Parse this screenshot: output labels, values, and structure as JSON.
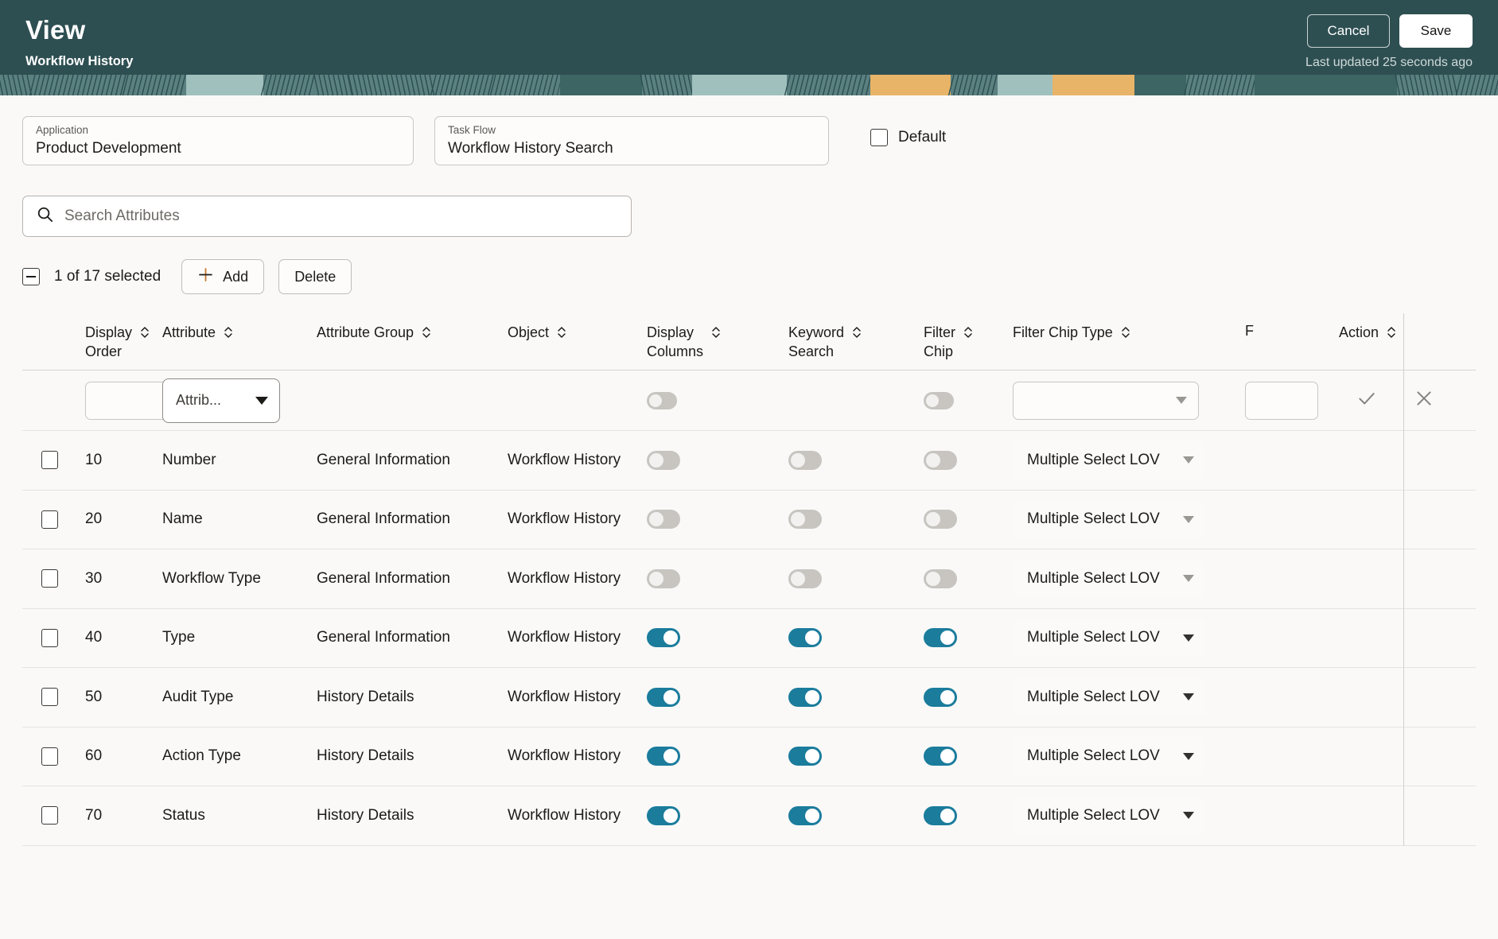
{
  "header": {
    "title": "View",
    "subtitle": "Workflow History",
    "cancel_label": "Cancel",
    "save_label": "Save",
    "last_updated": "Last updated 25 seconds ago",
    "bg_color": "#2e4f52"
  },
  "fields": {
    "application": {
      "label": "Application",
      "value": "Product Development"
    },
    "task_flow": {
      "label": "Task Flow",
      "value": "Workflow History Search"
    },
    "default": {
      "label": "Default",
      "checked": false
    }
  },
  "search": {
    "placeholder": "Search Attributes",
    "value": ""
  },
  "toolbar": {
    "selection_text": "1 of 17 selected",
    "add_label": "Add",
    "delete_label": "Delete",
    "add_icon": "plus-icon",
    "select_all_state": "indeterminate"
  },
  "table": {
    "columns": [
      {
        "key": "display_order",
        "label": "Display\nOrder",
        "sortable": true
      },
      {
        "key": "attribute",
        "label": "Attribute",
        "sortable": true
      },
      {
        "key": "attribute_group",
        "label": "Attribute Group",
        "sortable": true
      },
      {
        "key": "object",
        "label": "Object",
        "sortable": true
      },
      {
        "key": "display_columns",
        "label": "Display\nColumns",
        "sortable": true
      },
      {
        "key": "keyword_search",
        "label": "Keyword\nSearch",
        "sortable": true
      },
      {
        "key": "filter_chip",
        "label": "Filter\nChip",
        "sortable": true
      },
      {
        "key": "filter_chip_type",
        "label": "Filter Chip Type",
        "sortable": true
      },
      {
        "key": "truncated",
        "label": "F",
        "sortable": false
      },
      {
        "key": "action",
        "label": "Action",
        "sortable": true
      }
    ],
    "edit_row": {
      "display_order": "",
      "attribute_placeholder": "Attrib...",
      "display_columns": false,
      "filter_chip": false,
      "filter_chip_type": "",
      "confirm_icon": "check-icon",
      "cancel_icon": "close-icon"
    },
    "rows": [
      {
        "selected": false,
        "display_order": "10",
        "attribute": "Number",
        "attribute_group": "General Information",
        "object": "Workflow History",
        "display_columns": false,
        "keyword_search": false,
        "filter_chip": false,
        "filter_chip_type": "Multiple Select LOV",
        "disabled": true
      },
      {
        "selected": false,
        "display_order": "20",
        "attribute": "Name",
        "attribute_group": "General Information",
        "object": "Workflow History",
        "display_columns": false,
        "keyword_search": false,
        "filter_chip": false,
        "filter_chip_type": "Multiple Select LOV",
        "disabled": true
      },
      {
        "selected": false,
        "display_order": "30",
        "attribute": "Workflow Type",
        "attribute_group": "General Information",
        "object": "Workflow History",
        "display_columns": false,
        "keyword_search": false,
        "filter_chip": false,
        "filter_chip_type": "Multiple Select LOV",
        "disabled": true
      },
      {
        "selected": false,
        "display_order": "40",
        "attribute": "Type",
        "attribute_group": "General Information",
        "object": "Workflow History",
        "display_columns": true,
        "keyword_search": true,
        "filter_chip": true,
        "filter_chip_type": "Multiple Select LOV",
        "disabled": false
      },
      {
        "selected": false,
        "display_order": "50",
        "attribute": "Audit Type",
        "attribute_group": "History Details",
        "object": "Workflow History",
        "display_columns": true,
        "keyword_search": true,
        "filter_chip": true,
        "filter_chip_type": "Multiple Select LOV",
        "disabled": false
      },
      {
        "selected": false,
        "display_order": "60",
        "attribute": "Action Type",
        "attribute_group": "History Details",
        "object": "Workflow History",
        "display_columns": true,
        "keyword_search": true,
        "filter_chip": true,
        "filter_chip_type": "Multiple Select LOV",
        "disabled": false
      },
      {
        "selected": false,
        "display_order": "70",
        "attribute": "Status",
        "attribute_group": "History Details",
        "object": "Workflow History",
        "display_columns": true,
        "keyword_search": true,
        "filter_chip": true,
        "filter_chip_type": "Multiple Select LOV",
        "disabled": false
      }
    ]
  },
  "colors": {
    "toggle_on": "#1b7c9c",
    "toggle_off": "#c8c5c1",
    "accent_plus": "#c97b2e",
    "header_bg": "#2e4f52",
    "page_bg": "#faf9f8"
  }
}
